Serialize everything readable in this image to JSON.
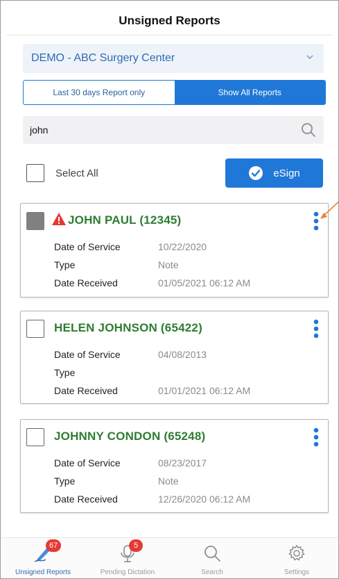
{
  "header": {
    "title": "Unsigned Reports"
  },
  "facility": {
    "selected": "DEMO - ABC Surgery Center"
  },
  "filter": {
    "left_label": "Last 30 days Report only",
    "right_label": "Show All Reports"
  },
  "search": {
    "value": "john"
  },
  "select_all": {
    "label": "Select All"
  },
  "esign": {
    "label": "eSign"
  },
  "reports": [
    {
      "patient": "JOHN PAUL (12345)",
      "date_of_service_label": "Date of Service",
      "date_of_service": "10/22/2020",
      "type_label": "Type",
      "type": "Note",
      "date_received_label": "Date Received",
      "date_received": "01/05/2021 06:12 AM",
      "warning": true,
      "checked": true
    },
    {
      "patient": "HELEN JOHNSON (65422)",
      "date_of_service_label": "Date of Service",
      "date_of_service": "04/08/2013",
      "type_label": "Type",
      "type": "",
      "date_received_label": "Date Received",
      "date_received": "01/01/2021 06:12 AM",
      "warning": false,
      "checked": false
    },
    {
      "patient": "JOHNNY CONDON (65248)",
      "date_of_service_label": "Date of Service",
      "date_of_service": "08/23/2017",
      "type_label": "Type",
      "type": "Note",
      "date_received_label": "Date Received",
      "date_received": "12/26/2020 06:12 AM",
      "warning": false,
      "checked": false
    }
  ],
  "tabs": [
    {
      "label": "Unsigned Reports",
      "badge": "67",
      "icon": "pen-signature-icon",
      "active": true
    },
    {
      "label": "Pending Dictation",
      "badge": "5",
      "icon": "microphone-icon",
      "active": false
    },
    {
      "label": "Search",
      "badge": "",
      "icon": "search-icon",
      "active": false
    },
    {
      "label": "Settings",
      "badge": "",
      "icon": "gear-icon",
      "active": false
    }
  ],
  "colors": {
    "accent": "#1f78d8",
    "patient_name": "#2e7d32",
    "badge": "#e53935",
    "warning": "#e53935",
    "annotation_arrow": "#e8833a"
  }
}
